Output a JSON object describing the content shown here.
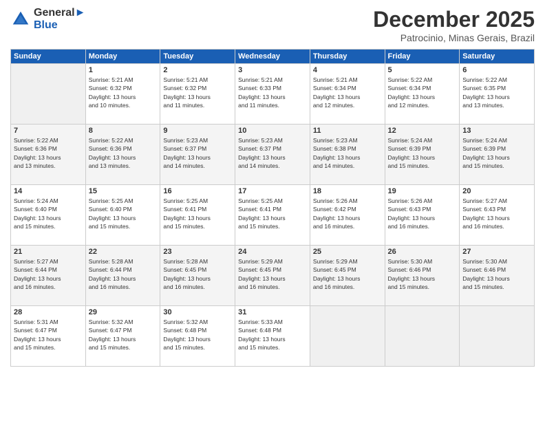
{
  "header": {
    "logo_line1": "General",
    "logo_line2": "Blue",
    "month": "December 2025",
    "location": "Patrocinio, Minas Gerais, Brazil"
  },
  "days_of_week": [
    "Sunday",
    "Monday",
    "Tuesday",
    "Wednesday",
    "Thursday",
    "Friday",
    "Saturday"
  ],
  "weeks": [
    [
      {
        "day": "",
        "info": ""
      },
      {
        "day": "1",
        "info": "Sunrise: 5:21 AM\nSunset: 6:32 PM\nDaylight: 13 hours\nand 10 minutes."
      },
      {
        "day": "2",
        "info": "Sunrise: 5:21 AM\nSunset: 6:32 PM\nDaylight: 13 hours\nand 11 minutes."
      },
      {
        "day": "3",
        "info": "Sunrise: 5:21 AM\nSunset: 6:33 PM\nDaylight: 13 hours\nand 11 minutes."
      },
      {
        "day": "4",
        "info": "Sunrise: 5:21 AM\nSunset: 6:34 PM\nDaylight: 13 hours\nand 12 minutes."
      },
      {
        "day": "5",
        "info": "Sunrise: 5:22 AM\nSunset: 6:34 PM\nDaylight: 13 hours\nand 12 minutes."
      },
      {
        "day": "6",
        "info": "Sunrise: 5:22 AM\nSunset: 6:35 PM\nDaylight: 13 hours\nand 13 minutes."
      }
    ],
    [
      {
        "day": "7",
        "info": "Sunrise: 5:22 AM\nSunset: 6:36 PM\nDaylight: 13 hours\nand 13 minutes."
      },
      {
        "day": "8",
        "info": "Sunrise: 5:22 AM\nSunset: 6:36 PM\nDaylight: 13 hours\nand 13 minutes."
      },
      {
        "day": "9",
        "info": "Sunrise: 5:23 AM\nSunset: 6:37 PM\nDaylight: 13 hours\nand 14 minutes."
      },
      {
        "day": "10",
        "info": "Sunrise: 5:23 AM\nSunset: 6:37 PM\nDaylight: 13 hours\nand 14 minutes."
      },
      {
        "day": "11",
        "info": "Sunrise: 5:23 AM\nSunset: 6:38 PM\nDaylight: 13 hours\nand 14 minutes."
      },
      {
        "day": "12",
        "info": "Sunrise: 5:24 AM\nSunset: 6:39 PM\nDaylight: 13 hours\nand 15 minutes."
      },
      {
        "day": "13",
        "info": "Sunrise: 5:24 AM\nSunset: 6:39 PM\nDaylight: 13 hours\nand 15 minutes."
      }
    ],
    [
      {
        "day": "14",
        "info": "Sunrise: 5:24 AM\nSunset: 6:40 PM\nDaylight: 13 hours\nand 15 minutes."
      },
      {
        "day": "15",
        "info": "Sunrise: 5:25 AM\nSunset: 6:40 PM\nDaylight: 13 hours\nand 15 minutes."
      },
      {
        "day": "16",
        "info": "Sunrise: 5:25 AM\nSunset: 6:41 PM\nDaylight: 13 hours\nand 15 minutes."
      },
      {
        "day": "17",
        "info": "Sunrise: 5:25 AM\nSunset: 6:41 PM\nDaylight: 13 hours\nand 15 minutes."
      },
      {
        "day": "18",
        "info": "Sunrise: 5:26 AM\nSunset: 6:42 PM\nDaylight: 13 hours\nand 16 minutes."
      },
      {
        "day": "19",
        "info": "Sunrise: 5:26 AM\nSunset: 6:43 PM\nDaylight: 13 hours\nand 16 minutes."
      },
      {
        "day": "20",
        "info": "Sunrise: 5:27 AM\nSunset: 6:43 PM\nDaylight: 13 hours\nand 16 minutes."
      }
    ],
    [
      {
        "day": "21",
        "info": "Sunrise: 5:27 AM\nSunset: 6:44 PM\nDaylight: 13 hours\nand 16 minutes."
      },
      {
        "day": "22",
        "info": "Sunrise: 5:28 AM\nSunset: 6:44 PM\nDaylight: 13 hours\nand 16 minutes."
      },
      {
        "day": "23",
        "info": "Sunrise: 5:28 AM\nSunset: 6:45 PM\nDaylight: 13 hours\nand 16 minutes."
      },
      {
        "day": "24",
        "info": "Sunrise: 5:29 AM\nSunset: 6:45 PM\nDaylight: 13 hours\nand 16 minutes."
      },
      {
        "day": "25",
        "info": "Sunrise: 5:29 AM\nSunset: 6:45 PM\nDaylight: 13 hours\nand 16 minutes."
      },
      {
        "day": "26",
        "info": "Sunrise: 5:30 AM\nSunset: 6:46 PM\nDaylight: 13 hours\nand 15 minutes."
      },
      {
        "day": "27",
        "info": "Sunrise: 5:30 AM\nSunset: 6:46 PM\nDaylight: 13 hours\nand 15 minutes."
      }
    ],
    [
      {
        "day": "28",
        "info": "Sunrise: 5:31 AM\nSunset: 6:47 PM\nDaylight: 13 hours\nand 15 minutes."
      },
      {
        "day": "29",
        "info": "Sunrise: 5:32 AM\nSunset: 6:47 PM\nDaylight: 13 hours\nand 15 minutes."
      },
      {
        "day": "30",
        "info": "Sunrise: 5:32 AM\nSunset: 6:48 PM\nDaylight: 13 hours\nand 15 minutes."
      },
      {
        "day": "31",
        "info": "Sunrise: 5:33 AM\nSunset: 6:48 PM\nDaylight: 13 hours\nand 15 minutes."
      },
      {
        "day": "",
        "info": ""
      },
      {
        "day": "",
        "info": ""
      },
      {
        "day": "",
        "info": ""
      }
    ]
  ]
}
